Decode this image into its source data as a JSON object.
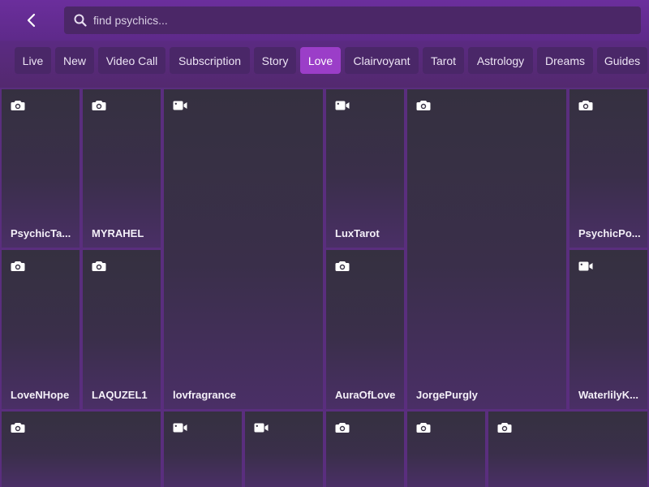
{
  "search": {
    "placeholder": "find psychics..."
  },
  "tabs": [
    {
      "label": "Live"
    },
    {
      "label": "New"
    },
    {
      "label": "Video Call"
    },
    {
      "label": "Subscription"
    },
    {
      "label": "Story"
    },
    {
      "label": "Love"
    },
    {
      "label": "Clairvoyant"
    },
    {
      "label": "Tarot"
    },
    {
      "label": "Astrology"
    },
    {
      "label": "Dreams"
    },
    {
      "label": "Guides"
    }
  ],
  "active_tab": "Love",
  "colors": {
    "header": "#6b2e9c",
    "tab": "#4a2768",
    "active_tab": "#9b3ec8",
    "tile": "#363042"
  },
  "tiles": [
    {
      "name": "PsychicTa...",
      "icon": "camera-icon"
    },
    {
      "name": "MYRAHEL",
      "icon": "camera-icon"
    },
    {
      "name": "lovfragrance",
      "icon": "video-icon"
    },
    {
      "name": "LuxTarot",
      "icon": "video-icon"
    },
    {
      "name": "JorgePurgly",
      "icon": "camera-icon"
    },
    {
      "name": "PsychicPo...",
      "icon": "camera-icon"
    },
    {
      "name": "LoveNHope",
      "icon": "camera-icon"
    },
    {
      "name": "LAQUZEL1",
      "icon": "camera-icon"
    },
    {
      "name": "AuraOfLove",
      "icon": "camera-icon"
    },
    {
      "name": "WaterlilyK...",
      "icon": "video-icon"
    },
    {
      "name": "",
      "icon": "camera-icon"
    },
    {
      "name": "",
      "icon": "video-icon"
    },
    {
      "name": "",
      "icon": "video-icon"
    },
    {
      "name": "",
      "icon": "camera-icon"
    },
    {
      "name": "",
      "icon": "camera-icon"
    },
    {
      "name": "",
      "icon": "camera-icon"
    }
  ]
}
